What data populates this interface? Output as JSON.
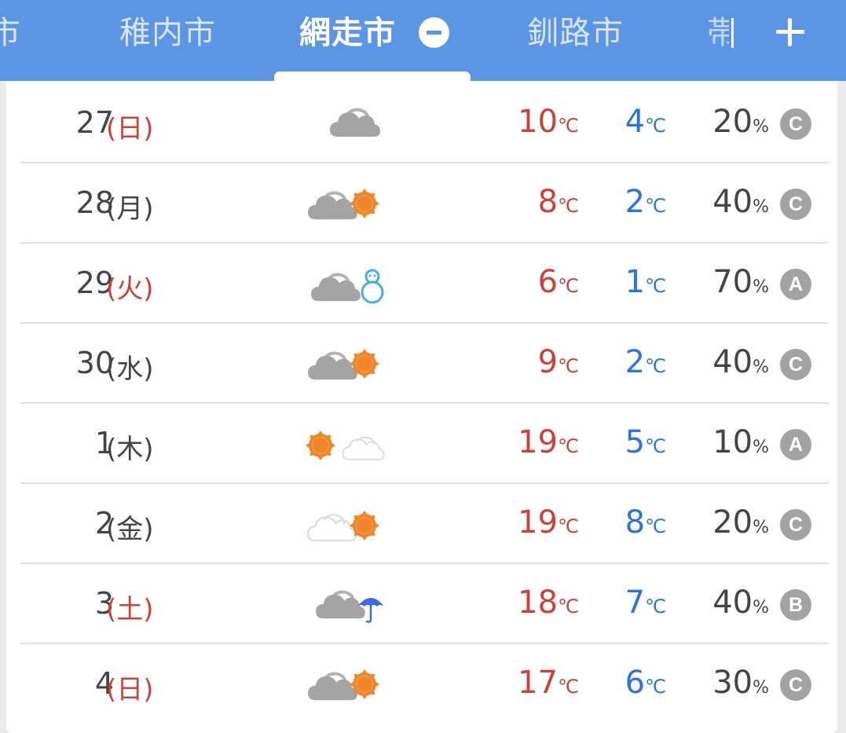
{
  "tabs": {
    "prev_partial": "市",
    "items": [
      "稚内市",
      "網走市",
      "釧路市"
    ],
    "next_partial": "帯"
  },
  "units": {
    "celsius": "℃",
    "percent": "%"
  },
  "forecast": [
    {
      "day": "27",
      "weekday": "(日)",
      "holiday": true,
      "weather": "cloudy",
      "high": "10",
      "low": "4",
      "pop": "20",
      "reliability": "C"
    },
    {
      "day": "28",
      "weekday": "(月)",
      "holiday": false,
      "weather": "cloudy-then-sunny",
      "high": "8",
      "low": "2",
      "pop": "40",
      "reliability": "C"
    },
    {
      "day": "29",
      "weekday": "(火)",
      "holiday": true,
      "weather": "cloudy-then-snow",
      "high": "6",
      "low": "1",
      "pop": "70",
      "reliability": "A"
    },
    {
      "day": "30",
      "weekday": "(水)",
      "holiday": false,
      "weather": "cloudy-then-sunny",
      "high": "9",
      "low": "2",
      "pop": "40",
      "reliability": "C"
    },
    {
      "day": "1",
      "weekday": "(木)",
      "holiday": false,
      "weather": "sunny-then-cloudy",
      "high": "19",
      "low": "5",
      "pop": "10",
      "reliability": "A"
    },
    {
      "day": "2",
      "weekday": "(金)",
      "holiday": false,
      "weather": "cloudy-then-sunny-light",
      "high": "19",
      "low": "8",
      "pop": "20",
      "reliability": "C"
    },
    {
      "day": "3",
      "weekday": "(土)",
      "holiday": true,
      "weather": "cloudy-then-rain",
      "high": "18",
      "low": "7",
      "pop": "40",
      "reliability": "B"
    },
    {
      "day": "4",
      "weekday": "(日)",
      "holiday": true,
      "weather": "cloudy-then-sunny",
      "high": "17",
      "low": "6",
      "pop": "30",
      "reliability": "C"
    }
  ],
  "colors": {
    "tabbar": "#5b95e4",
    "high_temp": "#c8433a",
    "low_temp": "#2e73dc",
    "holiday": "#c8433a",
    "sun": "#f0862a",
    "cloud_dark": "#a4a4a4",
    "cloud_light": "#dddddd",
    "snow": "#44aee4",
    "umbrella": "#4169d8",
    "badge": "#a3a3a3"
  }
}
